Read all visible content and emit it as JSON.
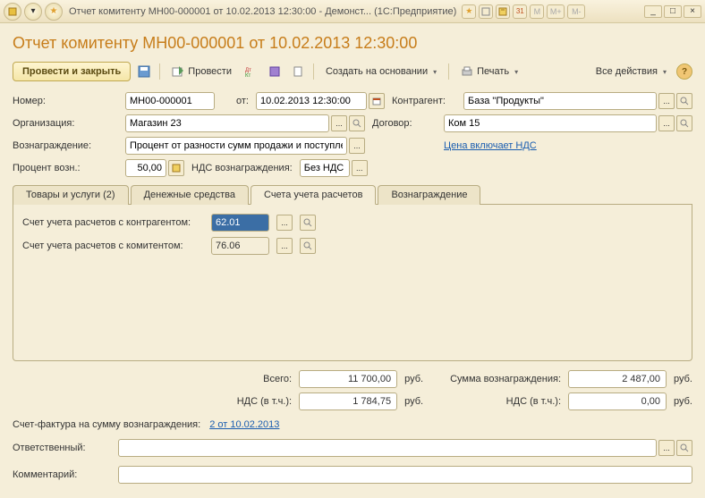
{
  "titlebar": {
    "text": "Отчет комитенту МН00-000001 от 10.02.2013 12:30:00 - Демонст...   (1С:Предприятие)",
    "m_labels": [
      "M",
      "M+",
      "M-"
    ]
  },
  "page_title": "Отчет комитенту МН00-000001 от 10.02.2013 12:30:00",
  "toolbar": {
    "main_btn": "Провести и закрыть",
    "post": "Провести",
    "create_based": "Создать на основании",
    "print": "Печать",
    "all_actions": "Все действия"
  },
  "fields": {
    "number_label": "Номер:",
    "number": "МН00-000001",
    "from_label": "от:",
    "date": "10.02.2013 12:30:00",
    "contractor_label": "Контрагент:",
    "contractor": "База \"Продукты\"",
    "org_label": "Организация:",
    "org": "Магазин 23",
    "contract_label": "Договор:",
    "contract": "Ком 15",
    "reward_label": "Вознаграждение:",
    "reward": "Процент от разности сумм продажи и поступления",
    "price_link": "Цена включает НДС",
    "percent_label": "Процент возн.:",
    "percent": "50,00",
    "vat_reward_label": "НДС вознаграждения:",
    "vat_reward": "Без НДС"
  },
  "tabs": {
    "t1": "Товары и услуги (2)",
    "t2": "Денежные средства",
    "t3": "Счета учета расчетов",
    "t4": "Вознаграждение"
  },
  "tab_content": {
    "row1_label": "Счет учета расчетов с контрагентом:",
    "row1_value": "62.01",
    "row2_label": "Счет учета расчетов с комитентом:",
    "row2_value": "76.06"
  },
  "totals": {
    "total_label": "Всего:",
    "total": "11 700,00",
    "vat_label": "НДС (в т.ч.):",
    "vat": "1 784,75",
    "reward_sum_label": "Сумма вознаграждения:",
    "reward_sum": "2 487,00",
    "vat2_label": "НДС (в т.ч.):",
    "vat2": "0,00",
    "unit": "руб."
  },
  "invoice": {
    "label": "Счет-фактура на сумму вознаграждения:",
    "link": "2 от 10.02.2013"
  },
  "bottom": {
    "responsible_label": "Ответственный:",
    "responsible": "",
    "comment_label": "Комментарий:",
    "comment": ""
  }
}
